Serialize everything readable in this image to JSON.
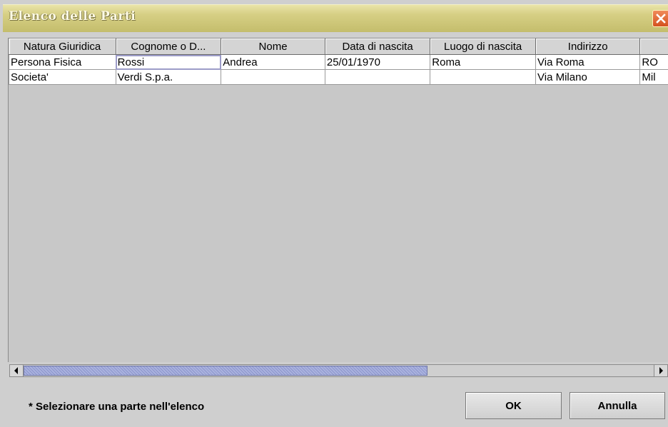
{
  "window": {
    "title": "Elenco delle Parti"
  },
  "table": {
    "columns": [
      "Natura Giuridica",
      "Cognome o D...",
      "Nome",
      "Data di nascita",
      "Luogo di nascita",
      "Indirizzo",
      ""
    ],
    "rows": [
      [
        "Persona Fisica",
        "Rossi",
        "Andrea",
        "25/01/1970",
        "Roma",
        "Via Roma",
        "RO"
      ],
      [
        "Societa'",
        "Verdi S.p.a.",
        "",
        "",
        "",
        "Via Milano",
        "Mil"
      ]
    ],
    "focused_cell": {
      "row": 0,
      "col": 1
    }
  },
  "footer": {
    "hint": "* Selezionare una parte nell'elenco",
    "ok_label": "OK",
    "cancel_label": "Annulla"
  },
  "icons": {
    "close": "close-icon",
    "scroll_left": "arrow-left-icon",
    "scroll_right": "arrow-right-icon"
  },
  "colors": {
    "titlebar": "#d6cf84",
    "close_button": "#e06a36",
    "scroll_thumb": "#aab2de"
  }
}
